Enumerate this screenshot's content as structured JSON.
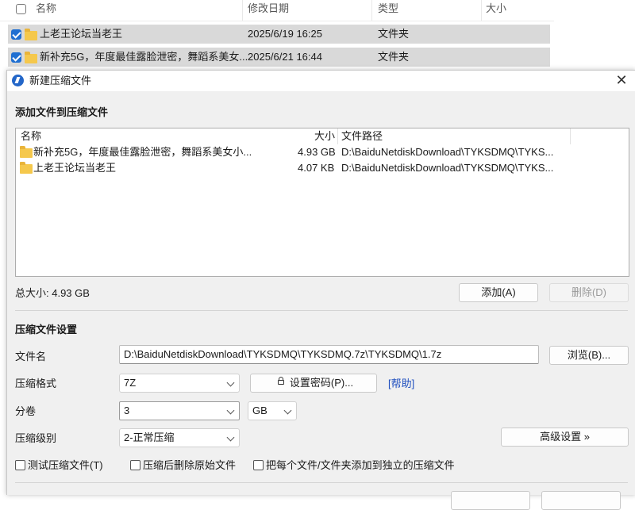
{
  "explorer": {
    "columns": {
      "name": "名称",
      "modified": "修改日期",
      "type": "类型",
      "size": "大小"
    },
    "rows": [
      {
        "name": "上老王论坛当老王",
        "modified": "2025/6/19 16:25",
        "type": "文件夹"
      },
      {
        "name": "新补充5G，年度最佳露脸泄密，舞蹈系美女...",
        "modified": "2025/6/21 16:44",
        "type": "文件夹"
      }
    ]
  },
  "dialog": {
    "title": "新建压缩文件",
    "close_icon": "close-icon",
    "add_section_title": "添加文件到压缩文件",
    "file_list": {
      "columns": {
        "name": "名称",
        "size": "大小",
        "path": "文件路径"
      },
      "rows": [
        {
          "name": "新补充5G，年度最佳露脸泄密，舞蹈系美女小...",
          "size": "4.93 GB",
          "path": "D:\\BaiduNetdiskDownload\\TYKSDMQ\\TYKS..."
        },
        {
          "name": "上老王论坛当老王",
          "size": "4.07 KB",
          "path": "D:\\BaiduNetdiskDownload\\TYKSDMQ\\TYKS..."
        }
      ]
    },
    "total_size": "总大小: 4.93 GB",
    "add_button": "添加(A)",
    "delete_button": "删除(D)",
    "settings_section_title": "压缩文件设置",
    "filename_label": "文件名",
    "filename_value": "D:\\BaiduNetdiskDownload\\TYKSDMQ\\TYKSDMQ.7z\\TYKSDMQ\\1.7z",
    "browse_button": "浏览(B)...",
    "format_label": "压缩格式",
    "format_value": "7Z",
    "password_button": "设置密码(P)...",
    "help_link": "[帮助]",
    "volume_label": "分卷",
    "volume_value": "3",
    "volume_unit": "GB",
    "level_label": "压缩级别",
    "level_value": "2-正常压缩",
    "advanced_button": "高级设置 »",
    "checkboxes": {
      "test": "测试压缩文件(T)",
      "delete_after": "压缩后删除原始文件",
      "each_separate": "把每个文件/文件夹添加到独立的压缩文件"
    }
  },
  "colors": {
    "accent": "#1f6fd1",
    "folder": "#f5c84c",
    "dialog_bg": "#f0f0f0",
    "link": "#1f4fbf"
  }
}
